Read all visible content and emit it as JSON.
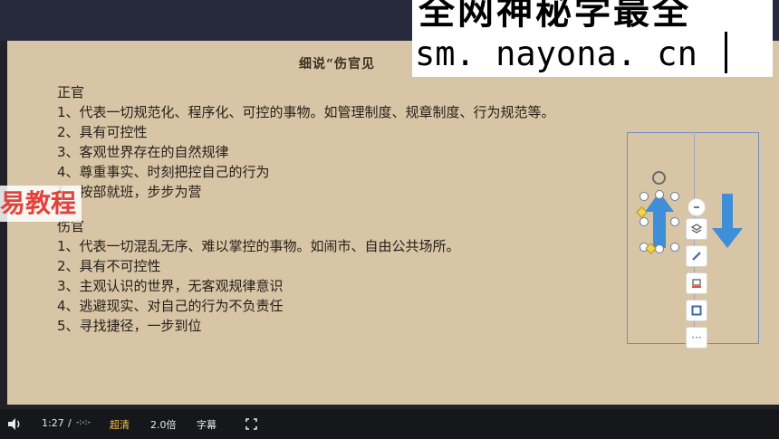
{
  "slide": {
    "title": "细说“伤官见",
    "zheng_heading": "正官",
    "zheng_items": [
      "1、代表一切规范化、程序化、可控的事物。如管理制度、规章制度、行为规范等。",
      "2、具有可控性",
      "3、客观世界存在的自然规律",
      "4、尊重事实、时刻把控自己的行为",
      "5、按部就班，步步为营"
    ],
    "shang_heading": "伤官",
    "shang_items": [
      "1、代表一切混乱无序、难以掌控的事物。如闹市、自由公共场所。",
      "2、具有不可控性",
      "3、主观认识的世界，无客观规律意识",
      "4、逃避现实、对自己的行为不负责任",
      "5、寻找捷径，一步到位"
    ]
  },
  "overlay": {
    "watermark_top": "全网神秘学最全",
    "watermark_url": "sm. nayona. cn",
    "course_stamp": "易教程"
  },
  "toolbar_icons": [
    "minus-icon",
    "layers-icon",
    "pen-icon",
    "fill-icon",
    "outline-icon",
    "more-icon"
  ],
  "toolbar_more": "···",
  "player": {
    "current_time": "1:27",
    "separator": "/",
    "duration": "-:-:-",
    "quality": "超清",
    "speed": "2.0倍",
    "subtitles": "字幕"
  },
  "colors": {
    "slide_bg": "#d8c5a6",
    "arrow_blue": "#3f8fd8",
    "quality_accent": "#f5c24a",
    "stamp_red": "#e2423c"
  }
}
